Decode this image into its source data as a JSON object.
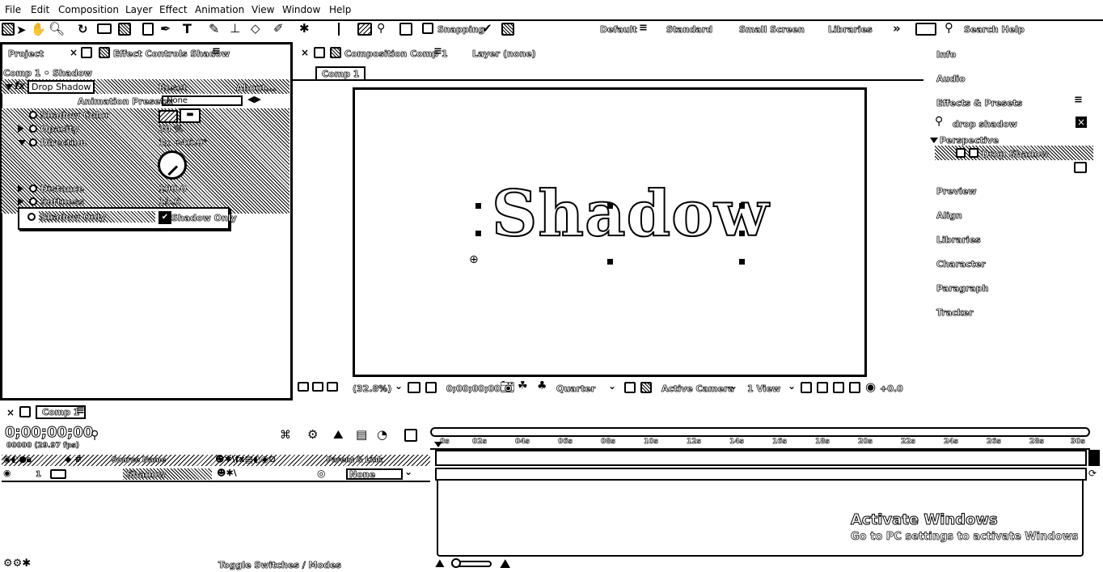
{
  "menu": [
    "File",
    "Edit",
    "Composition",
    "Layer",
    "Effect",
    "Animation",
    "View",
    "Window",
    "Help"
  ],
  "toolbar": {
    "snapping_label": "Snapping",
    "workspaces": [
      "Default",
      "Standard",
      "Small Screen",
      "Libraries"
    ],
    "search_help": "Search Help"
  },
  "left_panel": {
    "tab_project": "Project",
    "tab_effect_controls": "Effect Controls Shadow",
    "comp_layer": "Comp 1 • Shadow",
    "effect_name": "Drop Shadow",
    "reset": "Reset",
    "about": "About...",
    "animation_presets_label": "Animation Presets:",
    "animation_presets_value": "None",
    "props": [
      {
        "label": "Shadow Color",
        "value": ""
      },
      {
        "label": "Opacity",
        "value": "30 %"
      },
      {
        "label": "Direction",
        "value": "1x +46.0°"
      },
      {
        "label": "Distance",
        "value": "100.0"
      },
      {
        "label": "Softness",
        "value": "13.0"
      }
    ],
    "shadow_only_label": "Shadow Only",
    "shadow_only_checkbox": "Shadow Only"
  },
  "center_panel": {
    "tab_composition": "Composition Comp 1",
    "tab_layer": "Layer (none)",
    "comp_tab": "Comp 1",
    "canvas_text": "Shadow",
    "zoom": "(32.8%)",
    "timecode": "0;00;00;00",
    "resolution": "Quarter",
    "camera": "Active Camera",
    "views": "1 View",
    "exposure": "+0.0"
  },
  "right_panel": {
    "info": "Info",
    "audio": "Audio",
    "effects_presets": "Effects & Presets",
    "search_value": "drop shadow",
    "category": "Perspective",
    "effect_item": "Drop Shadow",
    "items": [
      "Preview",
      "Align",
      "Libraries",
      "Character",
      "Paragraph",
      "Tracker"
    ]
  },
  "timeline": {
    "comp_tab": "Comp 1",
    "timecode": "0;00;00;00",
    "frame_info": "00000 (29.97 fps)",
    "col_source_name": "Source Name",
    "col_parent": "Parent & Link",
    "layer_number": "1",
    "layer_name": "Shadow",
    "parent_value": "None",
    "ruler": [
      "0s",
      "02s",
      "04s",
      "06s",
      "08s",
      "10s",
      "12s",
      "14s",
      "16s",
      "18s",
      "20s",
      "22s",
      "24s",
      "26s",
      "28s",
      "30s"
    ],
    "toggle_label": "Toggle Switches / Modes"
  },
  "watermark": {
    "title": "Activate Windows",
    "subtitle": "Go to PC settings to activate Windows"
  }
}
